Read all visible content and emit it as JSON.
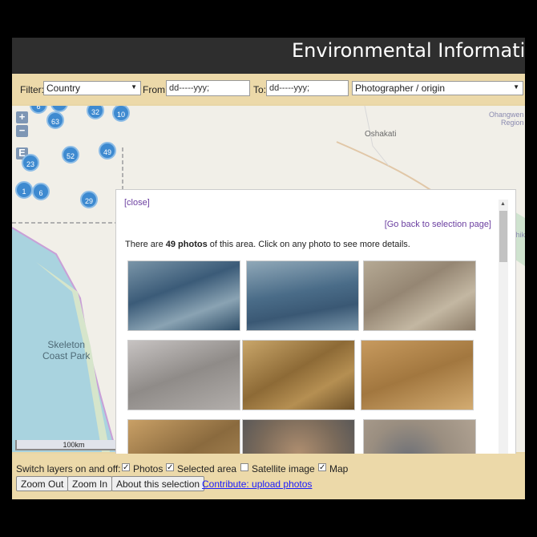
{
  "header": {
    "title": "Environmental Information"
  },
  "filter": {
    "label": "Filter:",
    "country": "Country",
    "from_label": "From:",
    "from_placeholder": "dd-----yyy;",
    "to_label": "To:",
    "to_placeholder": "dd-----yyy;",
    "photographer": "Photographer / origin"
  },
  "map": {
    "zoom_in": "+",
    "zoom_out": "−",
    "extent": "E",
    "clusters": [
      "6",
      "",
      "32",
      "10",
      "63",
      "52",
      "49",
      "23",
      "1",
      "6",
      "29"
    ],
    "labels": {
      "skeleton": "Skeleton\nCoast Park",
      "oshakati": "Oshakati",
      "ohangwena": "Ohangwen\nRegion",
      "oshikoto": "Oshik"
    },
    "scale": "100km"
  },
  "popup": {
    "close": "[close]",
    "back": "[Go back to selection page]",
    "info_prefix": "There are ",
    "info_count": "49 photos",
    "info_suffix": " of this area. Click on any photo to see more details."
  },
  "layers": {
    "label": "Switch layers on and off:",
    "photos": "Photos",
    "selected": "Selected area",
    "satellite": "Satellite image",
    "map": "Map"
  },
  "buttons": {
    "zoom_out": "Zoom Out",
    "zoom_in": "Zoom In",
    "about": "About this selection",
    "contribute": "Contribute: upload photos"
  }
}
